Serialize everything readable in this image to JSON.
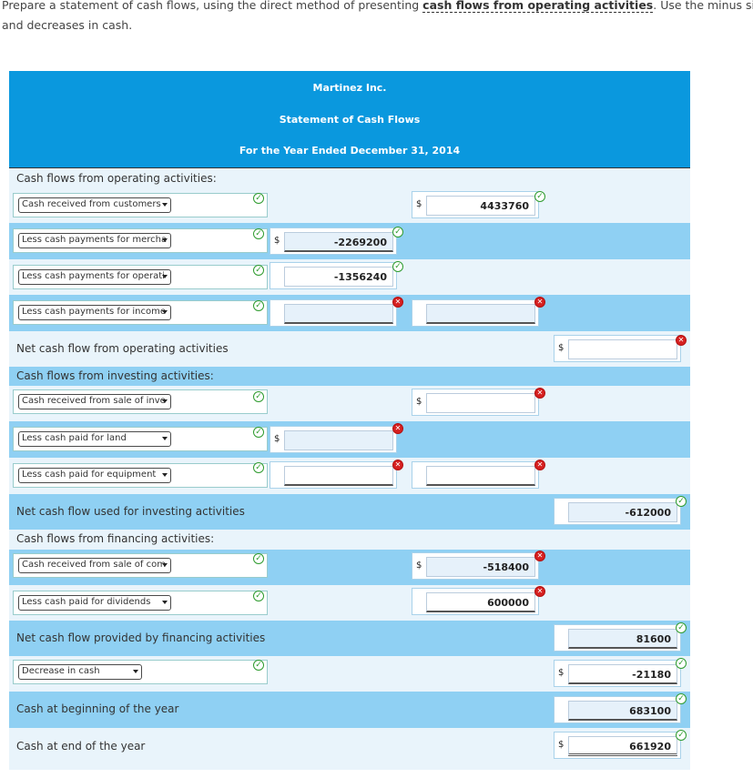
{
  "instructions": {
    "before_link": "Prepare a statement of cash flows, using the direct method of presenting ",
    "link": "cash flows from operating activities",
    "after_link": ". Use the minus sign to in",
    "line2": "and decreases in cash."
  },
  "header": {
    "company": "Martinez Inc.",
    "statement": "Statement of Cash Flows",
    "period": "For the Year Ended December 31, 2014"
  },
  "currency_symbol": "$",
  "labels": {
    "operating_heading": "Cash flows from operating activities:",
    "net_operating": "Net cash flow from operating activities",
    "investing_heading": "Cash flows from investing activities:",
    "net_investing": "Net cash flow used for investing activities",
    "financing_heading": "Cash flows from financing activities:",
    "net_financing": "Net cash flow provided by financing activities",
    "cash_beginning": "Cash at beginning of the year",
    "cash_end": "Cash at end of the year"
  },
  "selects": {
    "s1": "Cash received from customers",
    "s2": "Less cash payments for mercha",
    "s3": "Less cash payments for operati",
    "s4": "Less cash payments for income",
    "s5": "Cash received from sale of inve",
    "s6": "Less cash paid for land",
    "s7": "Less cash paid for equipment",
    "s8": "Cash received from sale of com",
    "s9": "Less cash paid for dividends",
    "s10": "Decrease in cash"
  },
  "values": {
    "r1_c3": "4433760",
    "r2_c2": "-2269200",
    "r3_c2": "-1356240",
    "r4_c2": "",
    "r4_c3": "",
    "net_operating": "",
    "r5_c3": "",
    "r6_c2": "",
    "r7_c2": "",
    "r7_c3": "",
    "net_investing": "-612000",
    "r8_c3": "-518400",
    "r9_c3": "600000",
    "net_financing": "81600",
    "decrease": "-21180",
    "beginning": "683100",
    "end": "661920"
  }
}
